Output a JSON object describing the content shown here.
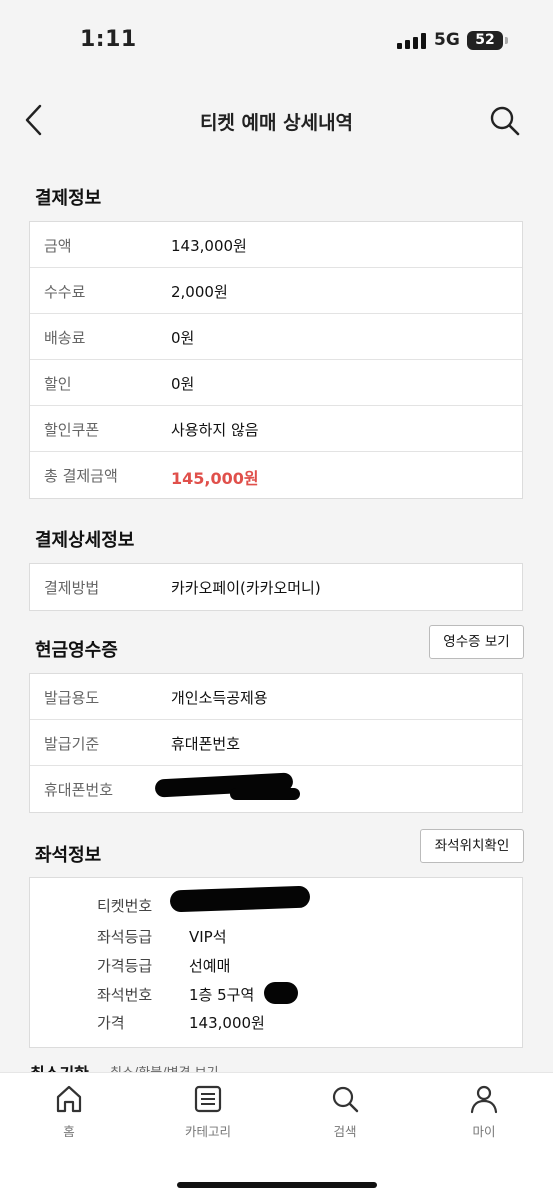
{
  "status_bar": {
    "time": "1:11",
    "network": "5G",
    "battery": "52"
  },
  "header": {
    "title": "티켓 예매 상세내역"
  },
  "payment": {
    "title": "결제정보",
    "rows": [
      {
        "label": "금액",
        "value": "143,000원"
      },
      {
        "label": "수수료",
        "value": "2,000원"
      },
      {
        "label": "배송료",
        "value": "0원"
      },
      {
        "label": "할인",
        "value": "0원"
      },
      {
        "label": "할인쿠폰",
        "value": "사용하지 않음"
      },
      {
        "label": "총 결제금액",
        "value": "145,000원"
      }
    ],
    "total_color": "#e0504b"
  },
  "payment_detail": {
    "title": "결제상세정보",
    "rows": [
      {
        "label": "결제방법",
        "value": "카카오페이(카카오머니)"
      }
    ]
  },
  "cash_receipt": {
    "title": "현금영수증",
    "button": "영수증 보기",
    "rows": [
      {
        "label": "발급용도",
        "value": "개인소득공제용"
      },
      {
        "label": "발급기준",
        "value": "휴대폰번호"
      },
      {
        "label": "휴대폰번호",
        "value": ""
      }
    ]
  },
  "seat": {
    "title": "좌석정보",
    "button": "좌석위치확인",
    "rows": [
      {
        "label": "티켓번호",
        "value": ""
      },
      {
        "label": "좌석등급",
        "value": "VIP석"
      },
      {
        "label": "가격등급",
        "value": "선예매"
      },
      {
        "label": "좌석번호",
        "value": "1층 5구역"
      },
      {
        "label": "가격",
        "value": "143,000원"
      }
    ]
  },
  "next_section": {
    "title": "취소기한",
    "subtitle": "취소/환불/변경 보기"
  },
  "tabbar": {
    "items": [
      {
        "label": "홈",
        "icon": "home-icon"
      },
      {
        "label": "카테고리",
        "icon": "list-icon"
      },
      {
        "label": "검색",
        "icon": "search-icon"
      },
      {
        "label": "마이",
        "icon": "person-icon"
      }
    ]
  }
}
